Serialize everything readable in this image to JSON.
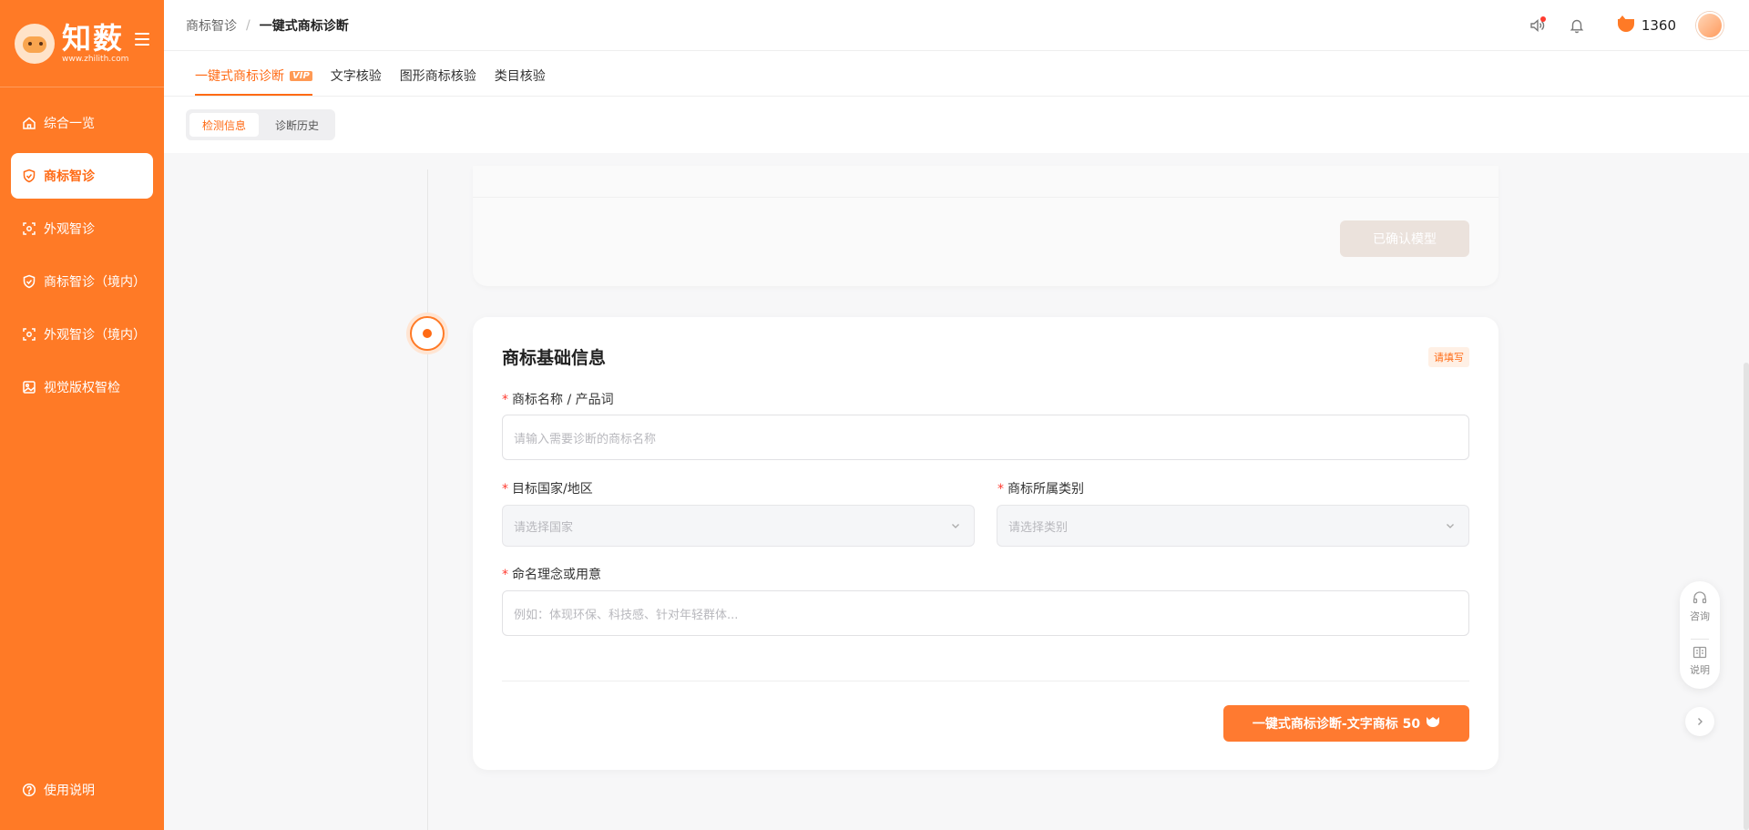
{
  "brand": {
    "name": "知薮",
    "subtitle": "www.zhilith.com"
  },
  "sidebar": {
    "items": [
      {
        "label": "综合一览",
        "icon": "home-icon"
      },
      {
        "label": "商标智诊",
        "icon": "shield-icon",
        "active": true
      },
      {
        "label": "外观智诊",
        "icon": "scan-icon"
      },
      {
        "label": "商标智诊（境内）",
        "icon": "shield-icon"
      },
      {
        "label": "外观智诊（境内）",
        "icon": "scan-icon"
      },
      {
        "label": "视觉版权智检",
        "icon": "image-icon"
      }
    ],
    "help_label": "使用说明"
  },
  "topbar": {
    "breadcrumb": [
      "商标智诊",
      "一键式商标诊断"
    ],
    "separator": "/",
    "coins": "1360"
  },
  "tabs": [
    {
      "label": "一键式商标诊断",
      "badge": "VIP",
      "active": true
    },
    {
      "label": "文字核验"
    },
    {
      "label": "图形商标核验"
    },
    {
      "label": "类目核验"
    }
  ],
  "subtabs": [
    {
      "label": "检测信息",
      "active": true
    },
    {
      "label": "诊断历史"
    }
  ],
  "prev_card": {
    "confirm_label": "已确认模型"
  },
  "form": {
    "title": "商标基础信息",
    "status_badge": "请填写",
    "required_mark": "*",
    "name_label": "商标名称 / 产品词",
    "name_placeholder": "请输入需要诊断的商标名称",
    "country_label": "目标国家/地区",
    "country_placeholder": "请选择国家",
    "category_label": "商标所属类别",
    "category_placeholder": "请选择类别",
    "concept_label": "命名理念或用意",
    "concept_placeholder": "例如：体现环保、科技感、针对年轻群体...",
    "submit_label": "一键式商标诊断-文字商标 50"
  },
  "float_panel": {
    "consult": "咨询",
    "guide": "说明"
  },
  "colors": {
    "brand": "#ff7a26",
    "accent": "#ff6a14"
  }
}
